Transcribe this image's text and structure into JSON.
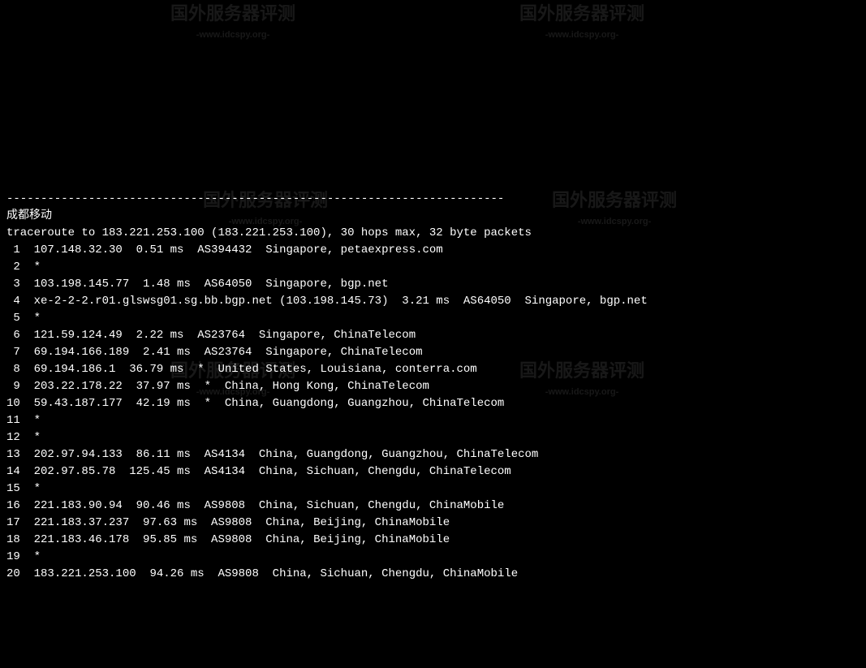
{
  "divider": "-------------------------------------------------------------------------",
  "title": "成都移动",
  "traceroute_header": "traceroute to 183.221.253.100 (183.221.253.100), 30 hops max, 32 byte packets",
  "hops": [
    {
      "n": " 1",
      "text": "  107.148.32.30  0.51 ms  AS394432  Singapore, petaexpress.com"
    },
    {
      "n": " 2",
      "text": "  *"
    },
    {
      "n": " 3",
      "text": "  103.198.145.77  1.48 ms  AS64050  Singapore, bgp.net"
    },
    {
      "n": " 4",
      "text": "  xe-2-2-2.r01.glswsg01.sg.bb.bgp.net (103.198.145.73)  3.21 ms  AS64050  Singapore, bgp.net"
    },
    {
      "n": " 5",
      "text": "  *"
    },
    {
      "n": " 6",
      "text": "  121.59.124.49  2.22 ms  AS23764  Singapore, ChinaTelecom"
    },
    {
      "n": " 7",
      "text": "  69.194.166.189  2.41 ms  AS23764  Singapore, ChinaTelecom"
    },
    {
      "n": " 8",
      "text": "  69.194.186.1  36.79 ms  *  United States, Louisiana, conterra.com"
    },
    {
      "n": " 9",
      "text": "  203.22.178.22  37.97 ms  *  China, Hong Kong, ChinaTelecom"
    },
    {
      "n": "10",
      "text": "  59.43.187.177  42.19 ms  *  China, Guangdong, Guangzhou, ChinaTelecom"
    },
    {
      "n": "11",
      "text": "  *"
    },
    {
      "n": "12",
      "text": "  *"
    },
    {
      "n": "13",
      "text": "  202.97.94.133  86.11 ms  AS4134  China, Guangdong, Guangzhou, ChinaTelecom"
    },
    {
      "n": "14",
      "text": "  202.97.85.78  125.45 ms  AS4134  China, Sichuan, Chengdu, ChinaTelecom"
    },
    {
      "n": "15",
      "text": "  *"
    },
    {
      "n": "16",
      "text": "  221.183.90.94  90.46 ms  AS9808  China, Sichuan, Chengdu, ChinaMobile"
    },
    {
      "n": "17",
      "text": "  221.183.37.237  97.63 ms  AS9808  China, Beijing, ChinaMobile"
    },
    {
      "n": "18",
      "text": "  221.183.46.178  95.85 ms  AS9808  China, Beijing, ChinaMobile"
    },
    {
      "n": "19",
      "text": "  *"
    },
    {
      "n": "20",
      "text": "  183.221.253.100  94.26 ms  AS9808  China, Sichuan, Chengdu, ChinaMobile"
    }
  ],
  "watermark": {
    "main": "国外服务器评测",
    "sub": "-www.idcspy.org-"
  }
}
